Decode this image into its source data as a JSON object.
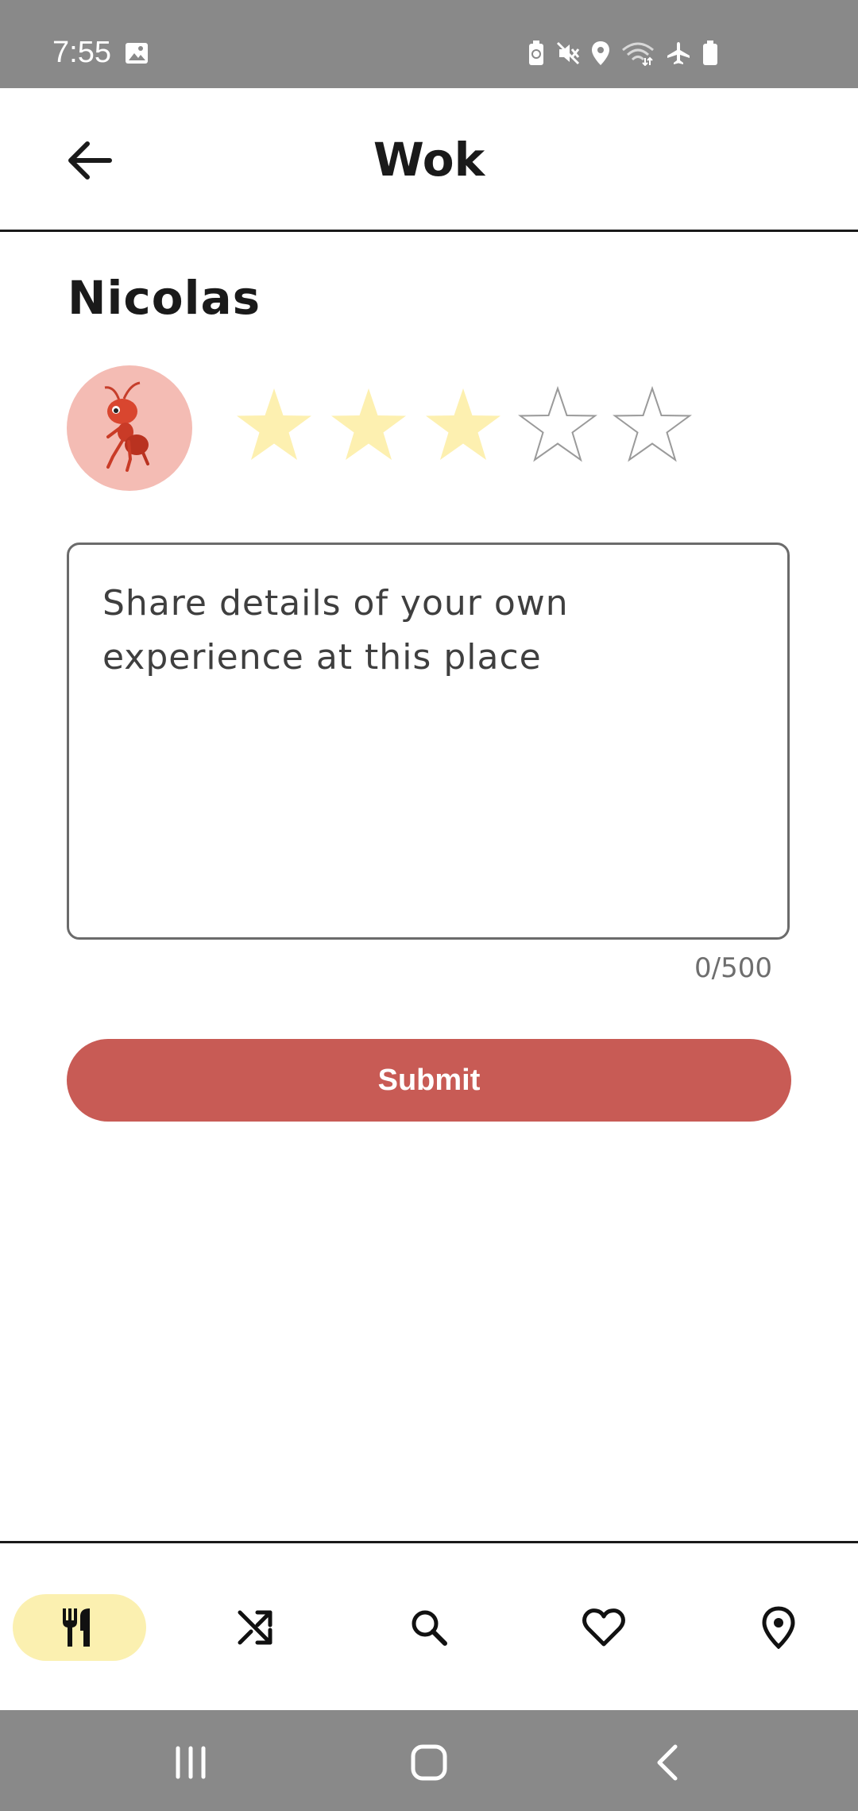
{
  "status_bar": {
    "time": "7:55",
    "icons": [
      "gallery-icon",
      "battery-saver-icon",
      "mute-icon",
      "location-icon",
      "wifi-icon",
      "airplane-icon",
      "battery-icon"
    ]
  },
  "app_bar": {
    "title": "Wok",
    "back_icon": "arrow-left-icon"
  },
  "review": {
    "user_name": "Nicolas",
    "avatar": "ant-avatar",
    "rating": 3,
    "max_rating": 5,
    "star_filled_color": "#fdf0b0",
    "star_empty_color": "#ffffff",
    "placeholder": "Share details of your own experience at this place",
    "char_count": "0/500",
    "submit_label": "Submit",
    "submit_color": "#c85b55"
  },
  "bottom_nav": {
    "items": [
      {
        "icon": "restaurant-icon",
        "active": true
      },
      {
        "icon": "shuffle-icon",
        "active": false
      },
      {
        "icon": "search-icon",
        "active": false
      },
      {
        "icon": "heart-icon",
        "active": false
      },
      {
        "icon": "location-pin-icon",
        "active": false
      }
    ],
    "active_color": "#fbf0b0"
  },
  "system_nav": {
    "buttons": [
      "recents-icon",
      "home-icon",
      "back-icon"
    ]
  }
}
